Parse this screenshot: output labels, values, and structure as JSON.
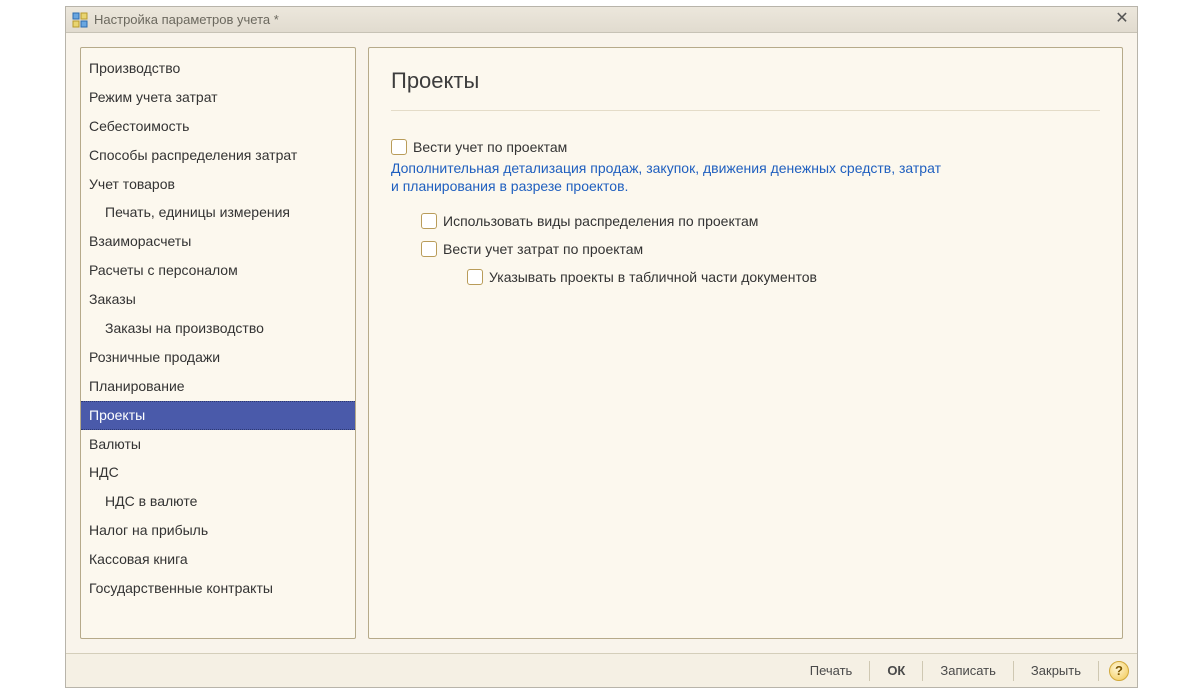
{
  "window": {
    "title": "Настройка параметров учета *"
  },
  "sidebar": {
    "items": [
      {
        "label": "Производство",
        "indent": 0,
        "active": false
      },
      {
        "label": "Режим учета затрат",
        "indent": 0,
        "active": false
      },
      {
        "label": "Себестоимость",
        "indent": 0,
        "active": false
      },
      {
        "label": "Способы распределения затрат",
        "indent": 0,
        "active": false
      },
      {
        "label": "Учет товаров",
        "indent": 0,
        "active": false
      },
      {
        "label": "Печать, единицы измерения",
        "indent": 1,
        "active": false
      },
      {
        "label": "Взаиморасчеты",
        "indent": 0,
        "active": false
      },
      {
        "label": "Расчеты с персоналом",
        "indent": 0,
        "active": false
      },
      {
        "label": "Заказы",
        "indent": 0,
        "active": false
      },
      {
        "label": "Заказы на производство",
        "indent": 1,
        "active": false
      },
      {
        "label": "Розничные продажи",
        "indent": 0,
        "active": false
      },
      {
        "label": "Планирование",
        "indent": 0,
        "active": false
      },
      {
        "label": "Проекты",
        "indent": 0,
        "active": true
      },
      {
        "label": "Валюты",
        "indent": 0,
        "active": false
      },
      {
        "label": "НДС",
        "indent": 0,
        "active": false
      },
      {
        "label": "НДС в валюте",
        "indent": 1,
        "active": false
      },
      {
        "label": "Налог на прибыль",
        "indent": 0,
        "active": false
      },
      {
        "label": "Кассовая книга",
        "indent": 0,
        "active": false
      },
      {
        "label": "Государственные контракты",
        "indent": 0,
        "active": false
      }
    ]
  },
  "content": {
    "heading": "Проекты",
    "checkbox1": "Вести учет по проектам",
    "hint": "Дополнительная детализация продаж, закупок, движения денежных средств, затрат и планирования в разрезе проектов.",
    "checkbox2": "Использовать виды распределения по проектам",
    "checkbox3": "Вести учет затрат по проектам",
    "checkbox4": "Указывать проекты в табличной части документов"
  },
  "footer": {
    "print": "Печать",
    "ok": "ОК",
    "save": "Записать",
    "close": "Закрыть"
  }
}
